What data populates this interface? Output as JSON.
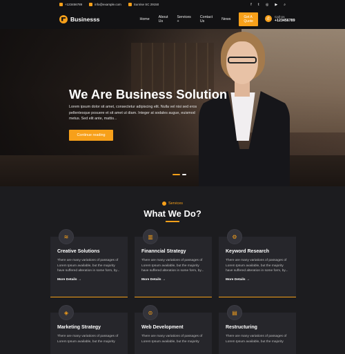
{
  "topbar": {
    "phone": "+123456789",
    "email": "info@example.com",
    "address": "Sunrise SC 29150",
    "social": [
      "f",
      "t",
      "ig",
      "yt",
      "search"
    ]
  },
  "nav": {
    "logo": "Businesss",
    "items": [
      "Home",
      "About Us",
      "Services +",
      "Contact Us",
      "News"
    ],
    "quote_button": "Get A Quote",
    "call_label": "Call Us",
    "call_number": "+123456789"
  },
  "hero": {
    "title": "We Are Business Solution",
    "text": "Lorem ipsum dolor sit amet, consectetur adipiscing elit. Nulla vel nisi sed eros pellentesque posuere et sit amet ut diam. Integer at sodales augue, euismod metus. Sed elit ante, mattis...",
    "button": "Continue reading"
  },
  "services": {
    "tag": "Services",
    "title": "What We Do?",
    "cards": [
      {
        "title": "Creative Solutions",
        "icon": "layers-icon",
        "text": "There are many variations of passages of Lorem Ipsum available, but the majority have suffered alteration in some form, by...",
        "more": "More Details →"
      },
      {
        "title": "Finanncial Strategy",
        "icon": "bar-chart-icon",
        "text": "There are many variations of passages of Lorem Ipsum available, but the majority have suffered alteration in some form, by...",
        "more": "More Details →"
      },
      {
        "title": "Keyword Research",
        "icon": "gear-icon",
        "text": "There are many variations of passages of Lorem Ipsum available, but the majority have suffered alteration in some form, by...",
        "more": "More Details →"
      },
      {
        "title": "Marketing Strategy",
        "icon": "megaphone-icon",
        "text": "There are many variations of passages of Lorem Ipsum available, but the majority",
        "more": ""
      },
      {
        "title": "Web Development",
        "icon": "code-icon",
        "text": "There are many variations of passages of Lorem Ipsum available, but the majority",
        "more": ""
      },
      {
        "title": "Restructuring",
        "icon": "chart-icon",
        "text": "There are many variations of passages of Lorem Ipsum available, but the majority",
        "more": ""
      }
    ]
  },
  "colors": {
    "accent": "#f7a01a",
    "background": "#1c1c1f",
    "card": "#26262b"
  }
}
